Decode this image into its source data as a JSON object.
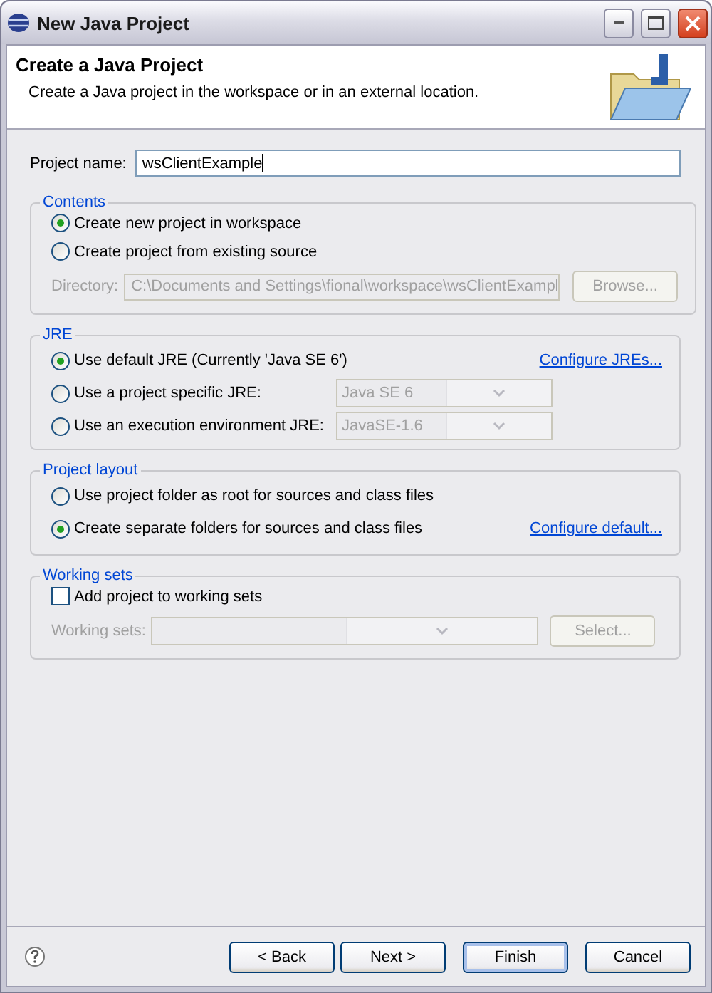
{
  "window": {
    "title": "New Java Project"
  },
  "header": {
    "title": "Create a Java Project",
    "description": "Create a Java project in the workspace or in an external location."
  },
  "project_name": {
    "label": "Project name:",
    "value": "wsClientExample"
  },
  "contents": {
    "title": "Contents",
    "options": [
      {
        "label": "Create new project in workspace",
        "selected": true
      },
      {
        "label": "Create project from existing source",
        "selected": false
      }
    ],
    "directory": {
      "label": "Directory:",
      "value": "C:\\Documents and Settings\\fional\\workspace\\wsClientExampl",
      "disabled": true
    },
    "browse": {
      "label": "Browse...",
      "disabled": true
    }
  },
  "jre": {
    "title": "JRE",
    "options": [
      {
        "kind": "link",
        "label": "Use default JRE (Currently 'Java SE 6')",
        "selected": true,
        "link": "Configure JREs..."
      },
      {
        "kind": "dropdown",
        "label": "Use a project specific JRE:",
        "selected": false,
        "value": "Java SE 6",
        "disabled": true
      },
      {
        "kind": "dropdown",
        "label": "Use an execution environment JRE:",
        "selected": false,
        "value": "JavaSE-1.6",
        "disabled": true
      }
    ]
  },
  "project_layout": {
    "title": "Project layout",
    "options": [
      {
        "kind": "plain",
        "label": "Use project folder as root for sources and class files",
        "selected": false
      },
      {
        "kind": "link",
        "label": "Create separate folders for sources and class files",
        "selected": true,
        "link": "Configure default..."
      }
    ]
  },
  "working_sets": {
    "title": "Working sets",
    "checkbox": {
      "label": "Add project to working sets",
      "checked": false
    },
    "field": {
      "label": "Working sets:",
      "disabled": true
    },
    "select": {
      "label": "Select...",
      "disabled": true
    }
  },
  "buttons": [
    {
      "label": "< Back",
      "default": false
    },
    {
      "label": "Next >",
      "default": false
    },
    {
      "label": "Finish",
      "default": true
    },
    {
      "label": "Cancel",
      "default": false
    }
  ]
}
